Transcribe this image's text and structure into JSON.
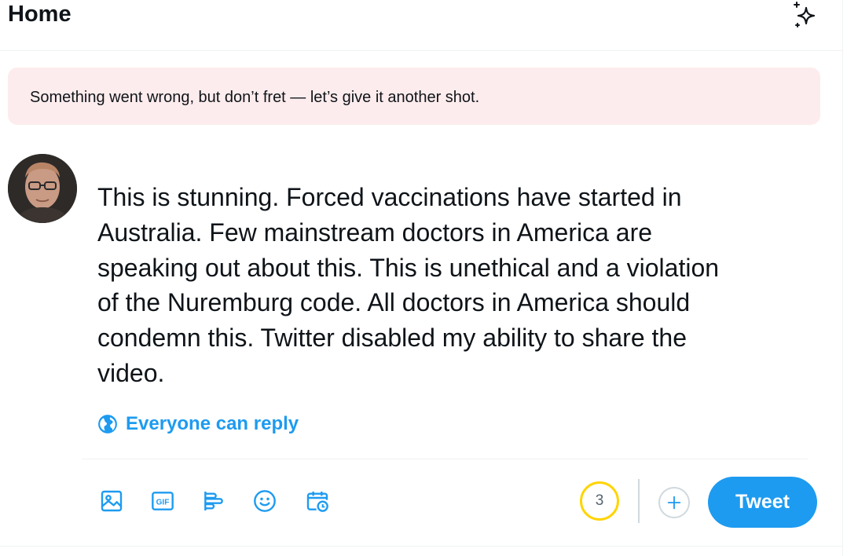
{
  "header": {
    "title": "Home",
    "sparkle_icon": "sparkle-icon"
  },
  "error_banner": {
    "message": "Something went wrong, but don’t fret — let’s give it another shot."
  },
  "composer": {
    "avatar": "user-avatar",
    "text": "This is stunning. Forced vaccinations have started in\nAustralia. Few mainstream doctors in America are\nspeaking out about this. This is unethical and a violation\nof the Nuremburg code. All doctors in America should\ncondemn this. Twitter disabled my ability to share the\nvideo.",
    "reply_setting": {
      "icon": "globe-icon",
      "label": "Everyone can reply"
    },
    "toolbar": {
      "icons": [
        "image-icon",
        "gif-icon",
        "poll-icon",
        "emoji-icon",
        "schedule-icon"
      ]
    },
    "char_counter": "3",
    "add_icon": "plus-icon",
    "tweet_button_label": "Tweet"
  },
  "colors": {
    "accent": "#1d9bf0",
    "error_bg": "#fdeced",
    "counter_ring": "#ffd400",
    "text": "#0f1419",
    "border": "#eff3f4"
  }
}
